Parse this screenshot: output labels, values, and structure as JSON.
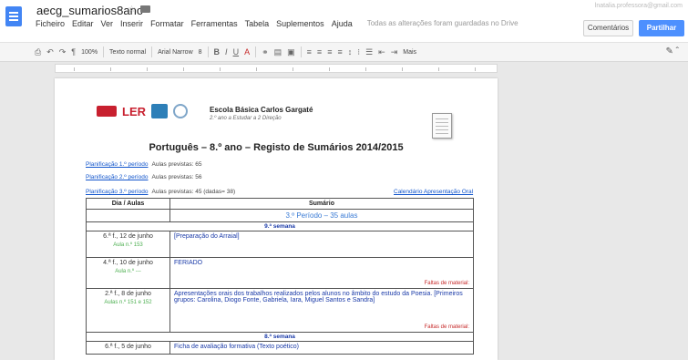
{
  "header": {
    "doc_title": "aecg_sumarios8ano",
    "user_email": "lnatalia.professora@gmail.com",
    "comments_label": "Comentários",
    "share_label": "Partilhar"
  },
  "menu": {
    "items": [
      "Ficheiro",
      "Editar",
      "Ver",
      "Inserir",
      "Formatar",
      "Ferramentas",
      "Tabela",
      "Suplementos",
      "Ajuda"
    ],
    "saved_note": "Todas as alterações foram guardadas no Drive"
  },
  "toolbar": {
    "zoom": "100%",
    "style": "Texto normal",
    "font": "Arial Narrow",
    "size": "8",
    "more": "Mais"
  },
  "page": {
    "school_name": "Escola Básica Carlos Gargaté",
    "school_sub": "2.º ano a Estudar a 2 Direção",
    "logo_ler": "LER",
    "title": "Português – 8.º ano – Registo de Sumários 2014/2015",
    "plan_lines": [
      {
        "link": "Planificação 1.º período",
        "text": "Aulas previstas: 65"
      },
      {
        "link": "Planificação 2.º período",
        "text": "Aulas previstas: 56"
      },
      {
        "link": "Planificação 3.º período",
        "text": "Aulas previstas: 45 (dadas= 38)"
      }
    ],
    "calendar_link": "Calendário Apresentação Oral"
  },
  "table": {
    "headers": [
      "Dia / Aulas",
      "Sumário"
    ],
    "period_label": "3.º Período – 35 aulas",
    "weeks": [
      {
        "label": "9.ª semana",
        "rows": [
          {
            "day": "6.ª f., 12 de junho",
            "aula": "Aula n.º 153",
            "summary": "[Preparação do Arraial]",
            "falta": ""
          },
          {
            "day": "4.ª f., 10 de junho",
            "aula": "Aula n.º ---",
            "summary": "FERIADO",
            "falta": "Faltas de material:"
          },
          {
            "day": "2.ª f., 8 de junho",
            "aula": "Aulas n.º 151 e 152",
            "summary": "Apresentações orais dos trabalhos realizados pelos alunos no âmbito do estudo da Poesia. [Primeiros grupos: Carolina, Diogo Fonte, Gabriela, Iara, Miguel Santos e Sandra]",
            "falta": "Faltas de material:"
          }
        ]
      },
      {
        "label": "8.ª semana",
        "rows": [
          {
            "day": "6.ª f., 5 de junho",
            "aula": "",
            "summary": "Ficha de avaliação formativa (Texto poético)",
            "falta": ""
          }
        ]
      }
    ]
  }
}
